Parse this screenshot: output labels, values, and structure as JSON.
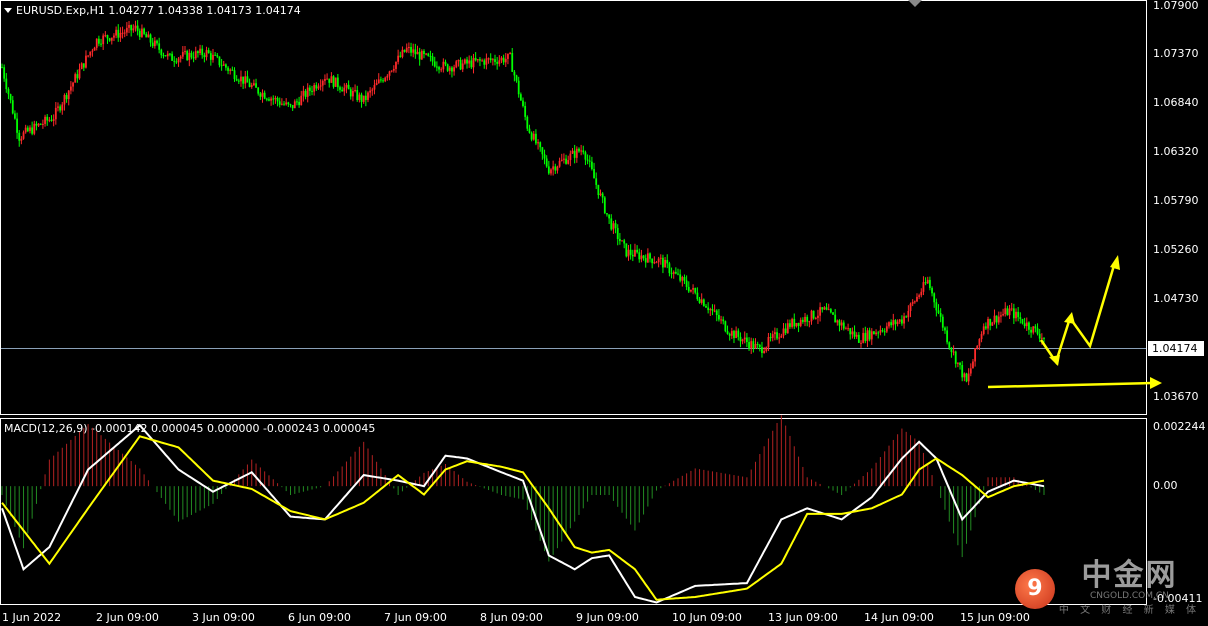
{
  "main_panel": {
    "header": "EURUSD.Exp,H1  1.04277 1.04338 1.04173 1.04174",
    "price_labels": [
      "1.07900",
      "1.07370",
      "1.06840",
      "1.06320",
      "1.05790",
      "1.05260",
      "1.04730",
      "1.04174",
      "1.03670"
    ],
    "current_price": "1.04174"
  },
  "macd_panel": {
    "header": "MACD(12,26,9) -0.000142 0.000045 0.000000 -0.000243 0.000045",
    "labels": [
      "0.002244",
      "0.00",
      "-0.00411"
    ]
  },
  "time_labels": [
    "1 Jun 2022",
    "2 Jun 09:00",
    "3 Jun 09:00",
    "6 Jun 09:00",
    "7 Jun 09:00",
    "8 Jun 09:00",
    "9 Jun 09:00",
    "10 Jun 09:00",
    "13 Jun 09:00",
    "14 Jun 09:00",
    "15 Jun 09:00"
  ],
  "watermark": {
    "brand": "中金网",
    "url": "CNGOLD.COM.CN",
    "sub": "中 文 财 经 新 媒 体"
  },
  "colors": {
    "bull": "#ff2a2a",
    "bear": "#00ff00",
    "macd_line": "#ffffff",
    "signal_line": "#ffff00",
    "arrow": "#ffff00",
    "hist_pos": "#b22222",
    "hist_neg": "#228b22"
  },
  "chart_data": {
    "type": "candlestick",
    "symbol": "EURUSD.Exp",
    "timeframe": "H1",
    "y_range": [
      1.0345,
      1.0795
    ],
    "price_waypoints": [
      {
        "i": 0,
        "p": 1.0725
      },
      {
        "i": 8,
        "p": 1.0648
      },
      {
        "i": 24,
        "p": 1.067
      },
      {
        "i": 44,
        "p": 1.0755
      },
      {
        "i": 62,
        "p": 1.0768
      },
      {
        "i": 78,
        "p": 1.0735
      },
      {
        "i": 95,
        "p": 1.0741
      },
      {
        "i": 118,
        "p": 1.07
      },
      {
        "i": 134,
        "p": 1.068
      },
      {
        "i": 150,
        "p": 1.0715
      },
      {
        "i": 168,
        "p": 1.0688
      },
      {
        "i": 188,
        "p": 1.0745
      },
      {
        "i": 206,
        "p": 1.0725
      },
      {
        "i": 224,
        "p": 1.0732
      },
      {
        "i": 236,
        "p": 1.0735
      },
      {
        "i": 244,
        "p": 1.066
      },
      {
        "i": 254,
        "p": 1.0612
      },
      {
        "i": 270,
        "p": 1.0635
      },
      {
        "i": 282,
        "p": 1.0555
      },
      {
        "i": 290,
        "p": 1.052
      },
      {
        "i": 306,
        "p": 1.051
      },
      {
        "i": 326,
        "p": 1.0465
      },
      {
        "i": 338,
        "p": 1.0432
      },
      {
        "i": 352,
        "p": 1.0412
      },
      {
        "i": 366,
        "p": 1.044
      },
      {
        "i": 382,
        "p": 1.0455
      },
      {
        "i": 398,
        "p": 1.0424
      },
      {
        "i": 418,
        "p": 1.0445
      },
      {
        "i": 430,
        "p": 1.0488
      },
      {
        "i": 440,
        "p": 1.0418
      },
      {
        "i": 448,
        "p": 1.0375
      },
      {
        "i": 456,
        "p": 1.044
      },
      {
        "i": 468,
        "p": 1.0455
      },
      {
        "i": 484,
        "p": 1.0425
      }
    ],
    "macd_waypoints": [
      {
        "i": 0,
        "m": -0.0008,
        "s": -0.0006
      },
      {
        "i": 10,
        "m": -0.003,
        "s": -0.0016
      },
      {
        "i": 22,
        "m": -0.0022,
        "s": -0.0028
      },
      {
        "i": 40,
        "m": 0.0006,
        "s": -0.0008
      },
      {
        "i": 64,
        "m": 0.0022,
        "s": 0.0018
      },
      {
        "i": 82,
        "m": 0.0006,
        "s": 0.0014
      },
      {
        "i": 98,
        "m": -0.0002,
        "s": 0.0002
      },
      {
        "i": 116,
        "m": 0.0005,
        "s": -0.0001
      },
      {
        "i": 134,
        "m": -0.0011,
        "s": -0.0009
      },
      {
        "i": 150,
        "m": -0.0012,
        "s": -0.0012
      },
      {
        "i": 168,
        "m": 0.0004,
        "s": -0.0006
      },
      {
        "i": 184,
        "m": 0.0002,
        "s": 0.0004
      },
      {
        "i": 196,
        "m": 0.0,
        "s": -0.0003
      },
      {
        "i": 206,
        "m": 0.0011,
        "s": 0.0006
      },
      {
        "i": 216,
        "m": 0.001,
        "s": 0.0009
      },
      {
        "i": 232,
        "m": 0.0005,
        "s": 0.0007
      },
      {
        "i": 242,
        "m": 0.0002,
        "s": 0.0005
      },
      {
        "i": 254,
        "m": -0.0025,
        "s": -0.0008
      },
      {
        "i": 266,
        "m": -0.003,
        "s": -0.0022
      },
      {
        "i": 274,
        "m": -0.0026,
        "s": -0.0024
      },
      {
        "i": 282,
        "m": -0.0025,
        "s": -0.0023
      },
      {
        "i": 294,
        "m": -0.004,
        "s": -0.003
      },
      {
        "i": 304,
        "m": -0.0042,
        "s": -0.0041
      },
      {
        "i": 322,
        "m": -0.0036,
        "s": -0.004
      },
      {
        "i": 346,
        "m": -0.0035,
        "s": -0.0037
      },
      {
        "i": 362,
        "m": -0.0012,
        "s": -0.0028
      },
      {
        "i": 374,
        "m": -0.0008,
        "s": -0.001
      },
      {
        "i": 390,
        "m": -0.0012,
        "s": -0.001
      },
      {
        "i": 404,
        "m": -0.0004,
        "s": -0.0008
      },
      {
        "i": 418,
        "m": 0.001,
        "s": -0.0003
      },
      {
        "i": 426,
        "m": 0.0016,
        "s": 0.0006
      },
      {
        "i": 434,
        "m": 0.001,
        "s": 0.001
      },
      {
        "i": 446,
        "m": -0.0012,
        "s": 0.0004
      },
      {
        "i": 458,
        "m": -0.0002,
        "s": -0.0004
      },
      {
        "i": 470,
        "m": 0.0002,
        "s": 0.0
      },
      {
        "i": 484,
        "m": 0.0,
        "s": 0.0002
      }
    ],
    "macd_y_range": [
      -0.00411,
      0.002244
    ],
    "bar_count": 485
  }
}
